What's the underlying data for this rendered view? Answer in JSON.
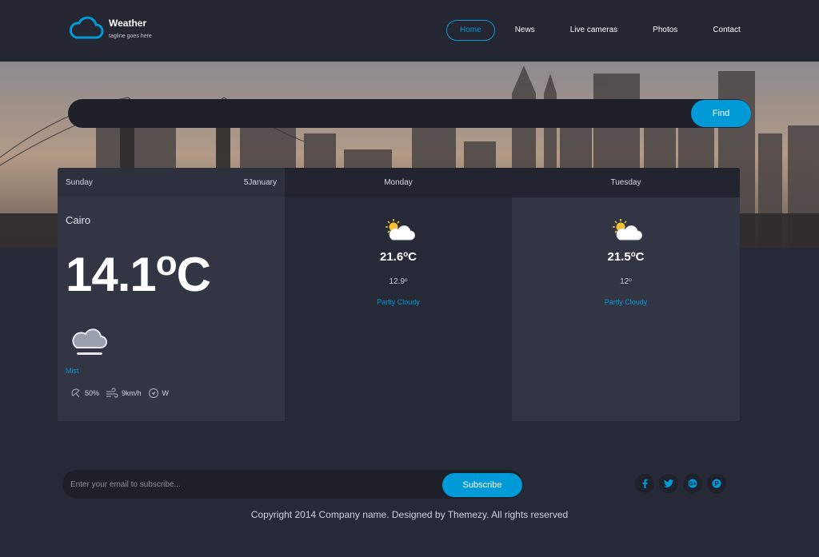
{
  "brand": {
    "title": "Weather",
    "tagline": "tagline goes here",
    "logo_icon": "cloud-logo-icon",
    "accent": "#009ad8"
  },
  "nav": {
    "items": [
      {
        "label": "Home",
        "active": true
      },
      {
        "label": "News"
      },
      {
        "label": "Live cameras"
      },
      {
        "label": "Photos"
      },
      {
        "label": "Contact"
      }
    ]
  },
  "search": {
    "value": "",
    "button_label": "Find"
  },
  "today": {
    "day": "Sunday",
    "date": "5January",
    "location": "Cairo",
    "temp": "14.1",
    "degree": "o",
    "unit": "C",
    "condition": "Mist",
    "icon": "mist-icon",
    "humidity": "50%",
    "wind_speed": "9km/h",
    "wind_direction": "W"
  },
  "forecast": [
    {
      "day": "Monday",
      "max": "21.6",
      "max_unit": "C",
      "min": "12.9",
      "degree": "o",
      "condition": "Partly Cloudy",
      "icon": "partly-cloudy-icon"
    },
    {
      "day": "Tuesday",
      "max": "21.5",
      "max_unit": "C",
      "min": "12",
      "degree": "o",
      "condition": "Partly Cloudy",
      "icon": "partly-cloudy-icon"
    }
  ],
  "subscribe": {
    "placeholder": "Enter your email to subscribe...",
    "button_label": "Subscribe"
  },
  "socials": [
    {
      "icon": "facebook-icon",
      "glyph": "f"
    },
    {
      "icon": "twitter-icon",
      "glyph": "t"
    },
    {
      "icon": "google-plus-icon",
      "glyph": "G"
    },
    {
      "icon": "pinterest-icon",
      "glyph": "P"
    }
  ],
  "footer": {
    "copyright": "Copyright 2014 Company name. Designed by Themezy. All rights reserved"
  },
  "colors": {
    "background": "#262936",
    "panel": "#323544",
    "accent": "#009ad8"
  }
}
